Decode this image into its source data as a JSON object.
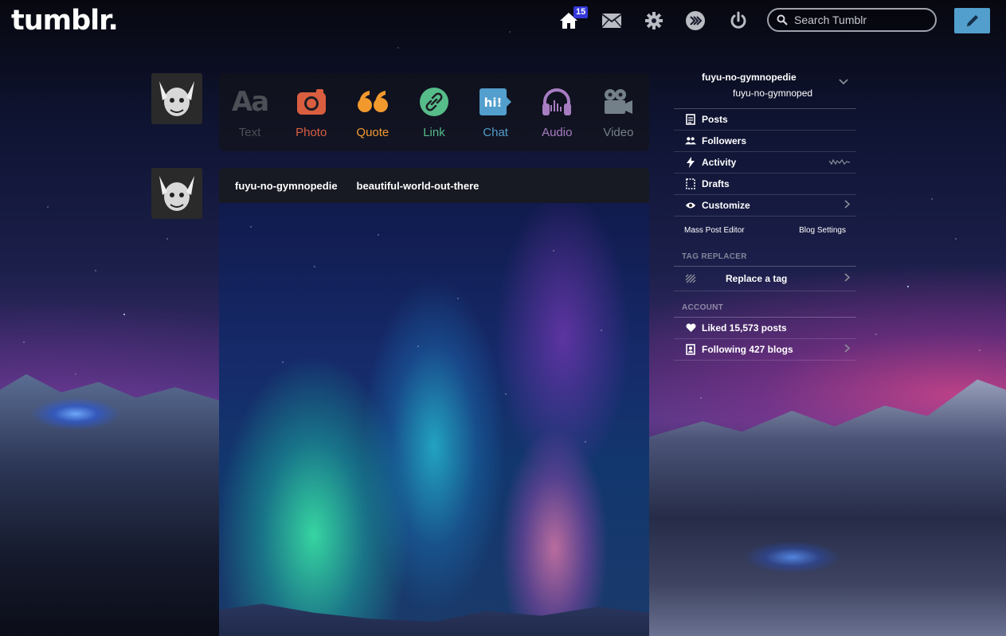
{
  "header": {
    "logo": "tumblr.",
    "dashboard_badge": "15",
    "search_placeholder": "Search Tumblr"
  },
  "post_types": [
    {
      "label": "Text",
      "color": "#4c4f55"
    },
    {
      "label": "Photo",
      "color": "#d95e40"
    },
    {
      "label": "Quote",
      "color": "#f2992e"
    },
    {
      "label": "Link",
      "color": "#56bc8a"
    },
    {
      "label": "Chat",
      "color": "#529ecc"
    },
    {
      "label": "Audio",
      "color": "#a77dc2"
    },
    {
      "label": "Video",
      "color": "#748089"
    }
  ],
  "post": {
    "author": "fuyu-no-gymnopedie",
    "reblogged_from": "beautiful-world-out-there"
  },
  "sidebar": {
    "blog_name": "fuyu-no-gymnopedie",
    "blog_title": "fuyu-no-gymnoped",
    "menu": {
      "posts": "Posts",
      "followers": "Followers",
      "activity": "Activity",
      "drafts": "Drafts",
      "customize": "Customize"
    },
    "mass_post_editor": "Mass Post Editor",
    "blog_settings": "Blog Settings",
    "tag_replacer_label": "TAG REPLACER",
    "replace_tag": "Replace a tag",
    "account_label": "ACCOUNT",
    "liked": "Liked 15,573 posts",
    "following": "Following 427 blogs"
  },
  "colors": {
    "compose_button": "#529ecc",
    "badge": "#3538d9"
  }
}
